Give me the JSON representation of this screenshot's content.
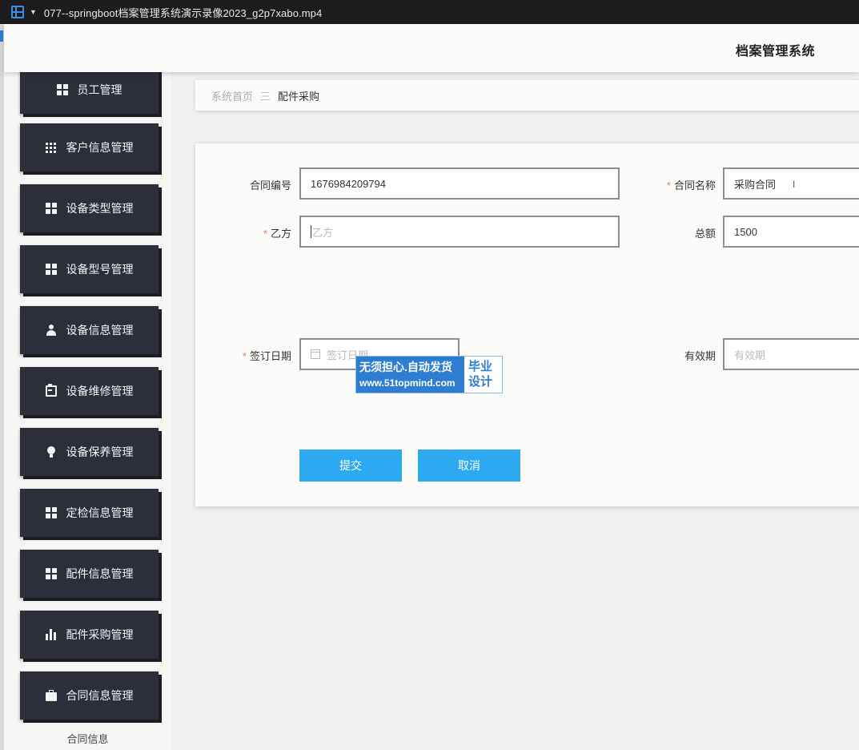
{
  "player": {
    "file_title": "077--springboot档案管理系统演示录像2023_g2p7xabo.mp4"
  },
  "header": {
    "system_title": "档案管理系统"
  },
  "sidebar": {
    "items": [
      {
        "label": "员工管理",
        "icon": "grid-icon"
      },
      {
        "label": "客户信息管理",
        "icon": "table-icon"
      },
      {
        "label": "设备类型管理",
        "icon": "grid-icon"
      },
      {
        "label": "设备型号管理",
        "icon": "grid-icon"
      },
      {
        "label": "设备信息管理",
        "icon": "user-icon"
      },
      {
        "label": "设备维修管理",
        "icon": "clipboard-icon"
      },
      {
        "label": "设备保养管理",
        "icon": "lightbulb-icon"
      },
      {
        "label": "定检信息管理",
        "icon": "grid-icon"
      },
      {
        "label": "配件信息管理",
        "icon": "grid-icon"
      },
      {
        "label": "配件采购管理",
        "icon": "bar-chart-icon"
      },
      {
        "label": "合同信息管理",
        "icon": "briefcase-icon"
      }
    ],
    "footer_label": "合同信息"
  },
  "breadcrumb": {
    "home": "系统首页",
    "separator": "三",
    "current": "配件采购"
  },
  "form": {
    "contract_no": {
      "label": "合同编号",
      "value": "1676984209794"
    },
    "contract_name": {
      "label": "合同名称",
      "value": "采购合同",
      "required": true
    },
    "party_b": {
      "label": "乙方",
      "placeholder": "乙方",
      "required": true
    },
    "total": {
      "label": "总额",
      "value": "1500"
    },
    "sign_date": {
      "label": "签订日期",
      "placeholder": "签订日期",
      "required": true
    },
    "validity": {
      "label": "有效期",
      "placeholder": "有效期"
    },
    "submit_label": "提交",
    "cancel_label": "取消",
    "required_mark": "*"
  },
  "watermark": {
    "line1": "无须担心.自动发货",
    "line2": "www.51topmind.com",
    "right1": "毕业",
    "right2": "设计"
  },
  "colors": {
    "sidebar_item_bg": "#2c2f3a",
    "primary_button": "#2eaaf2",
    "required_star": "#f56c6c"
  }
}
